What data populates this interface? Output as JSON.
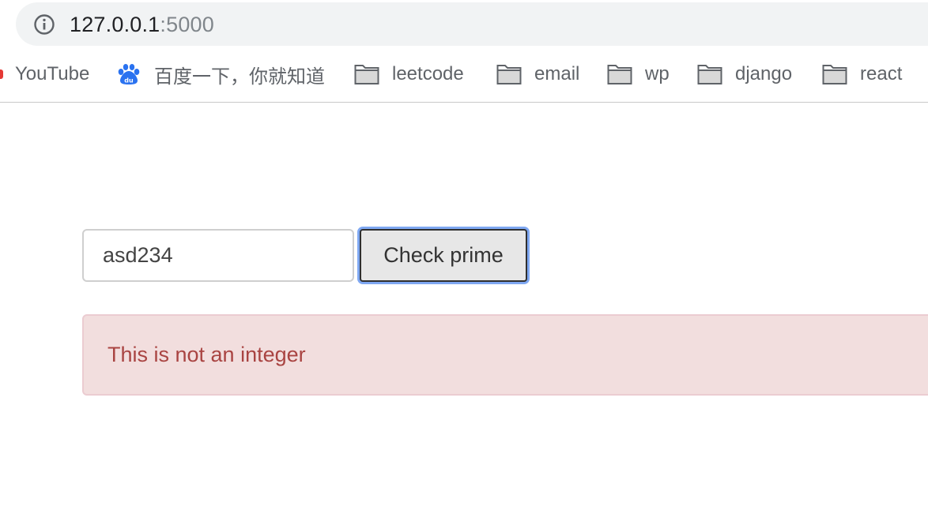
{
  "browser": {
    "url_host": "127.0.0.1",
    "url_port": ":5000",
    "bookmarks": [
      {
        "label": "YouTube",
        "icon": "youtube-icon"
      },
      {
        "label": "百度一下，你就知道",
        "icon": "baidu-paw-icon"
      },
      {
        "label": "leetcode",
        "icon": "folder-icon"
      },
      {
        "label": "email",
        "icon": "folder-icon"
      },
      {
        "label": "wp",
        "icon": "folder-icon"
      },
      {
        "label": "django",
        "icon": "folder-icon"
      },
      {
        "label": "react",
        "icon": "folder-icon"
      }
    ]
  },
  "form": {
    "input_value": "asd234",
    "button_label": "Check prime"
  },
  "alert": {
    "message": "This is not an integer"
  },
  "colors": {
    "alert_background": "#f2dede",
    "alert_border": "#ebccd1",
    "alert_text": "#a94442",
    "focus_ring": "#7fa8f2",
    "baidu_blue": "#2a72f0"
  }
}
